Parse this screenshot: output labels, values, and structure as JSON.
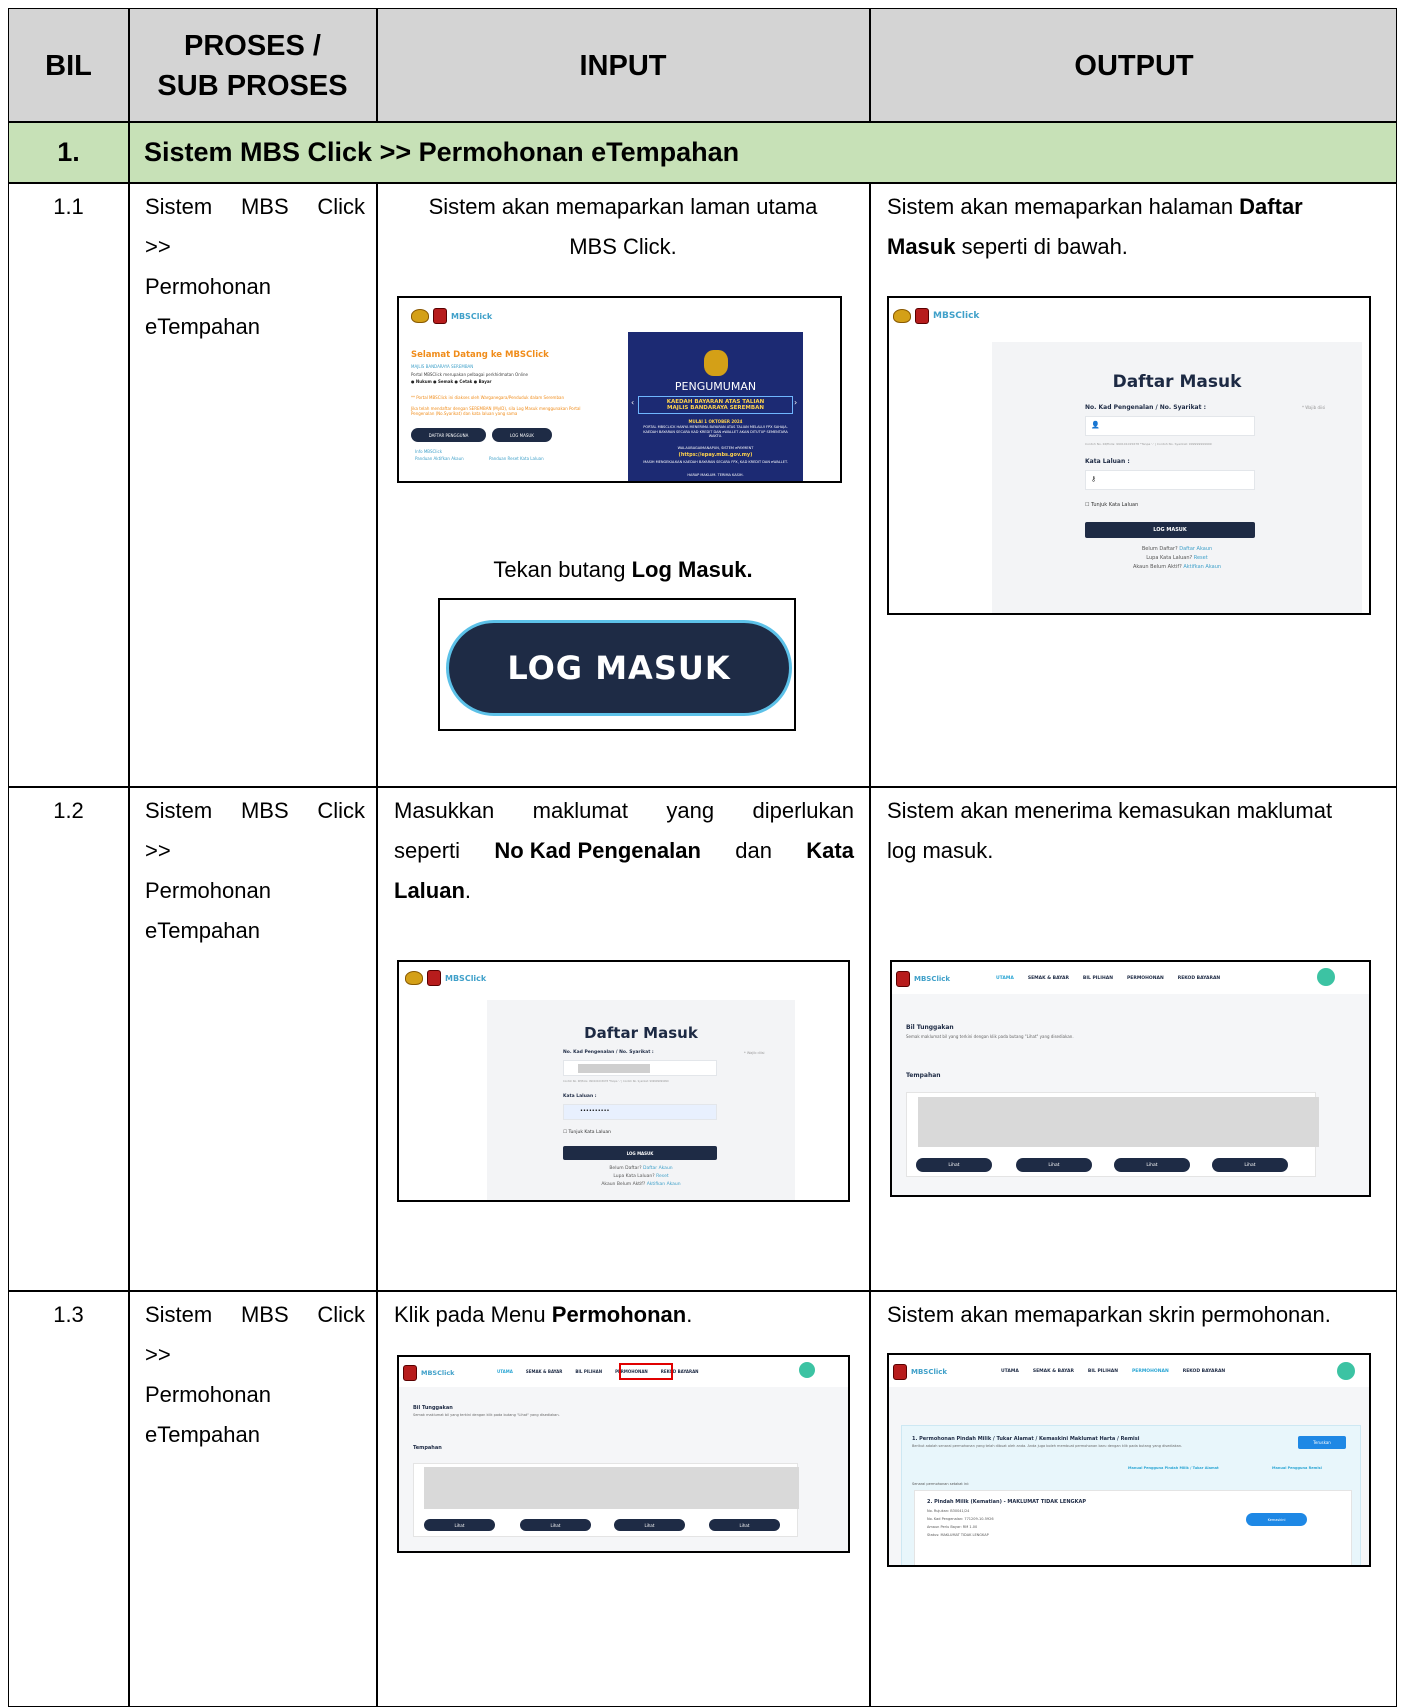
{
  "header": {
    "bil": "BIL",
    "proses_line1": "PROSES /",
    "proses_line2": "SUB PROSES",
    "input": "INPUT",
    "output": "OUTPUT"
  },
  "section": {
    "number": "1.",
    "title": "Sistem MBS Click >> Permohonan eTempahan"
  },
  "rows": [
    {
      "bil": "1.1",
      "proses": [
        "Sistem MBS Click",
        ">>",
        "Permohonan",
        "eTempahan"
      ],
      "input_text_1": "Sistem akan memaparkan laman utama",
      "input_text_2": "MBS Click.",
      "input_text_3_pre": "Tekan butang ",
      "input_text_3_bold": "Log Masuk.",
      "output_pre": "Sistem akan memaparkan halaman ",
      "output_bold_1": "Daftar",
      "output_bold_2": "Masuk",
      "output_post": " seperti di bawah."
    },
    {
      "bil": "1.2",
      "proses": [
        "Sistem MBS Click",
        ">>",
        "Permohonan",
        "eTempahan"
      ],
      "input_l1_a": "Masukkan",
      "input_l1_b": "maklumat",
      "input_l1_c": "yang",
      "input_l1_d": "diperlukan",
      "input_l2_a": "seperti ",
      "input_l2_b": "No Kad Pengenalan",
      "input_l2_c": " dan ",
      "input_l2_d": "Kata",
      "input_l3_a": "Laluan",
      "input_l3_b": ".",
      "output_l1": "Sistem akan menerima kemasukan maklumat",
      "output_l2": "log masuk."
    },
    {
      "bil": "1.3",
      "proses": [
        "Sistem MBS Click",
        ">>",
        "Permohonan",
        "eTempahan"
      ],
      "input_pre": "Klik pada Menu ",
      "input_bold": "Permohonan",
      "input_post": ".",
      "output": "Sistem akan memaparkan skrin permohonan."
    }
  ],
  "shots": {
    "brand": "MBSClick",
    "home": {
      "welcome": "Selamat Datang ke MBSClick",
      "majlis": "MAJLIS BANDARAYA SEREMBAN",
      "portal": "Portal MBSClick merupakan pelbagai perkhidmatan Online",
      "bullets": "● Nukum  ● Semak  ● Cetak  ● Bayar",
      "notice": "** Portal MBSClick ini diakses oleh Warganegara/Penduduk dalam Seremban",
      "notice2": "Jika telah mendaftar dengan SEREMBAN (MyID), sila Log Masuk menggunakan Portal Pengenalan (No.Syarikat) dan kata laluan yang sama",
      "btn_daftar": "DAFTAR PENGGUNA",
      "btn_log": "LOG MASUK",
      "link1": "Info MBSClick",
      "link2": "Panduan Aktifkan Akaun",
      "link3": "Panduan Reset Kata Laluan",
      "poster_title": "PENGUMUMAN",
      "poster_sub1": "KAEDAH BAYARAN ATAS TALIAN",
      "poster_sub2": "MAJLIS BANDARAYA SEREMBAN",
      "poster_date": "MULAI 1 OKTOBER 2024",
      "poster_body": "PORTAL MBSCLICK HANYA MENERIMA BAYARAN ATAS TALIAN MELALUI FPX SAHAJA. KAEDAH BAYARAN SECARA KAD KREDIT DAN eWALLET AKAN DITUTUP SEMENTARA WAKTU.",
      "poster_alt": "WALAUBAGAIMANAPUN, SISTEM ePAYMENT",
      "poster_url": "(https://epay.mbs.gov.my)",
      "poster_alt2": "MASIH MENGEKALKAN KAEDAH BAYARAN SECARA FPX, KAD KREDIT DAN eWALLET.",
      "poster_end": "HARAP MAKLUM. TERIMA KASIH."
    },
    "big_button": "LOG MASUK",
    "login": {
      "title": "Daftar Masuk",
      "id_label": "No. Kad Pengenalan / No. Syarikat :",
      "wajib": "* Wajib diisi",
      "hint": "Contoh No. KP/Polis: 990101015678 *Tanpa '-' | Contoh No. Syarikat: 999999999999",
      "pw_label": "Kata Laluan :",
      "pw_value": "••••••••••",
      "show_pw": "Tunjuk Kata Laluan",
      "btn": "LOG MASUK",
      "belum": "Belum Daftar? ",
      "belum_link": "Daftar Akaun",
      "lupa": "Lupa Kata Laluan? ",
      "lupa_link": "Reset",
      "akaun": "Akaun Belum Aktif? ",
      "akaun_link": "Aktifkan Akaun"
    },
    "dashboard": {
      "nav": [
        "UTAMA",
        "SEMAK & BAYAR",
        "BIL PILIHAN",
        "PERMOHONAN",
        "REKOD BAYARAN"
      ],
      "bil_title": "Bil Tunggakan",
      "bil_sub": "Semak maklumat bil yang terkini dengan klik pada butang \"Lihat\" yang disediakan.",
      "tempahan": "Tempahan",
      "lihat": "Lihat"
    },
    "permohonan": {
      "heading": "1. Permohonan Pindah Milik / Tukar Alamat / Kemaskini Maklumat Harta / Remisi",
      "desc": "Berikut adalah senarai permohonan yang telah dibuat oleh anda. Anda juga boleh membuat permohonan baru dengan klik pada butang yang disediakan.",
      "teruskan": "Teruskan",
      "manual1": "Manual Pengguna Pindah Milik / Tukar Alamat",
      "manual2": "Manual Pengguna Remisi",
      "senarai": "Senarai permohonan setakat ini:",
      "item_title": "2. Pindah Milik (Kematian) - MAKLUMAT TIDAK LENGKAP",
      "rujukan": "No. Rujukan: B30041/24",
      "kp": "No. Kad Pengenalan: 771209-10-5926",
      "amaun": "Amaun Perlu Bayar: RM 1.00",
      "status": "Status: MAKLUMAT TIDAK LENGKAP",
      "kemaskini": "Kemaskini"
    }
  },
  "colors": {
    "header_bg": "#d4d4d4",
    "section_bg": "#c7e1b7",
    "brand_blue": "#3fa0c9",
    "dark_navy": "#1e2b45",
    "highlight_red": "#e00000"
  }
}
